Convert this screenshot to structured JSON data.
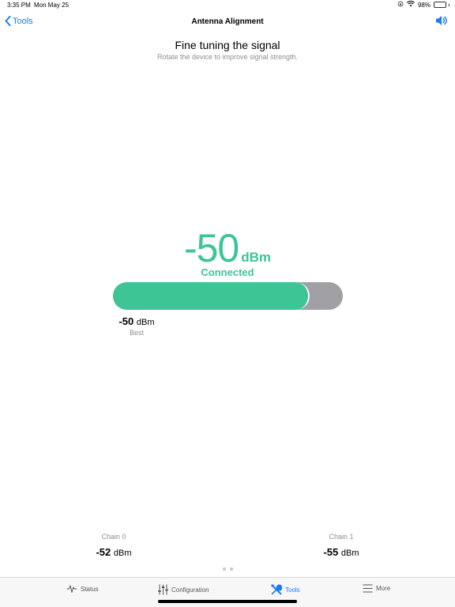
{
  "status_bar": {
    "time": "3:35 PM",
    "date": "Mon May 25",
    "battery": "98%",
    "battery_level": 0.98
  },
  "nav": {
    "back_label": "Tools",
    "title": "Antenna Alignment",
    "speaker_icon": "speaker-icon"
  },
  "heading": {
    "title": "Fine tuning the signal",
    "subtitle": "Rotate the device to improve signal strength."
  },
  "signal": {
    "value": "-50",
    "unit": "dBm",
    "status": "Connected",
    "bar_level": 0.855,
    "accent_color": "#3dc596",
    "bar_bg_color": "#a1a1a5"
  },
  "best": {
    "value": "-50",
    "unit": "dBm",
    "label": "Best"
  },
  "chains": [
    {
      "label": "Chain 0",
      "value": "-52",
      "unit": "dBm"
    },
    {
      "label": "Chain 1",
      "value": "-55",
      "unit": "dBm"
    }
  ],
  "page_control": {
    "pages": 2,
    "current": 1
  },
  "tab_bar": {
    "items": [
      {
        "label": "Status",
        "icon": "pulse-icon",
        "active": false
      },
      {
        "label": "Configuration",
        "icon": "sliders-icon",
        "active": false
      },
      {
        "label": "Tools",
        "icon": "tools-icon",
        "active": true
      },
      {
        "label": "More",
        "icon": "menu-icon",
        "active": false
      }
    ],
    "active_color": "#1a7cf5"
  }
}
